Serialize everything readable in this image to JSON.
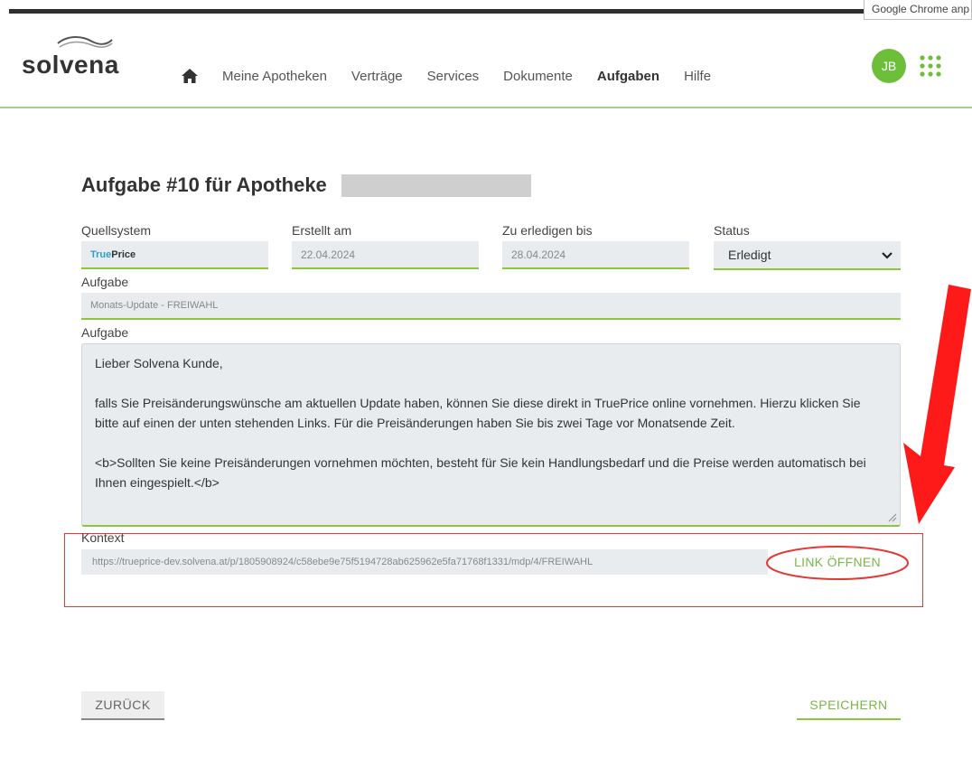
{
  "browser": {
    "tooltip": "Google Chrome anp"
  },
  "header": {
    "logo_text": "solvena",
    "nav": {
      "home_icon": "home-icon",
      "items": [
        "Meine Apotheken",
        "Verträge",
        "Services",
        "Dokumente",
        "Aufgaben",
        "Hilfe"
      ],
      "active": "Aufgaben"
    },
    "avatar_initials": "JB",
    "apps_icon": "grid-apps-icon",
    "accent_color": "#8cc63f"
  },
  "page": {
    "title": "Aufgabe #10 für Apotheke",
    "fields": {
      "quellsystem": {
        "label": "Quellsystem",
        "value_part1": "True",
        "value_part2": "Price"
      },
      "erstellt_am": {
        "label": "Erstellt am",
        "value": "22.04.2024"
      },
      "zu_erledigen_bis": {
        "label": "Zu erledigen bis",
        "value": "28.04.2024"
      },
      "status": {
        "label": "Status",
        "value": "Erledigt"
      },
      "aufgabe_title": {
        "label": "Aufgabe",
        "value": "Monats-Update - FREIWAHL"
      },
      "aufgabe_text": {
        "label": "Aufgabe",
        "paragraphs": [
          "Lieber Solvena Kunde,",
          "falls Sie Preisänderungswünsche am aktuellen Update haben, können Sie diese direkt in TruePrice online vornehmen. Hierzu klicken Sie bitte auf einen der unten stehenden Links. Für die Preisänderungen haben Sie bis zwei Tage vor Monatsende Zeit.",
          "<b>Sollten Sie keine Preisänderungen vornehmen möchten, besteht für Sie kein Handlungsbedarf und die Preise werden automatisch bei Ihnen eingespielt.</b>"
        ]
      },
      "kontext": {
        "label": "Kontext",
        "link": "https://trueprice-dev.solvena.at/p/1805908924/c58ebe9e75f5194728ab625962e5fa71768f1331/mdp/4/FREIWAHL",
        "button": "LINK ÖFFNEN"
      }
    },
    "buttons": {
      "back": "ZURÜCK",
      "save": "SPEICHERN"
    }
  },
  "annotations": {
    "highlight_color": "#e53935"
  }
}
